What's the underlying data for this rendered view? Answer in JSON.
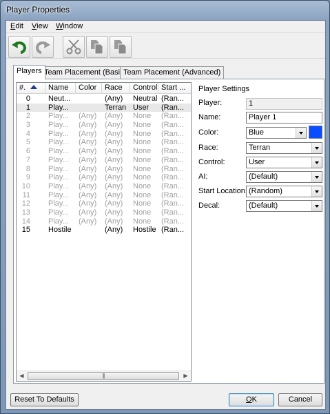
{
  "window": {
    "title": "Player Properties"
  },
  "menu": [
    {
      "key": "E",
      "rest": "dit"
    },
    {
      "key": "V",
      "rest": "iew"
    },
    {
      "key": "W",
      "rest": "indow"
    }
  ],
  "toolbar": {
    "buttons": [
      "undo-icon",
      "redo-icon",
      "cut-icon",
      "copy-icon",
      "paste-icon"
    ]
  },
  "tabs": [
    "Players",
    "Team Placement (Basic)",
    "Team Placement (Advanced)"
  ],
  "table": {
    "columns": [
      "#.",
      "Name",
      "Color",
      "Race",
      "Control",
      "Start ..."
    ],
    "rows": [
      [
        "0",
        "Neut...",
        "",
        "(Any)",
        "Neutral",
        "(Ran..."
      ],
      [
        "1",
        "Play...",
        "",
        "Terran",
        "User",
        "(Ran..."
      ],
      [
        "2",
        "Play...",
        "(Any)",
        "(Any)",
        "None",
        "(Ran..."
      ],
      [
        "3",
        "Play...",
        "(Any)",
        "(Any)",
        "None",
        "(Ran..."
      ],
      [
        "4",
        "Play...",
        "(Any)",
        "(Any)",
        "None",
        "(Ran..."
      ],
      [
        "5",
        "Play...",
        "(Any)",
        "(Any)",
        "None",
        "(Ran..."
      ],
      [
        "6",
        "Play...",
        "(Any)",
        "(Any)",
        "None",
        "(Ran..."
      ],
      [
        "7",
        "Play...",
        "(Any)",
        "(Any)",
        "None",
        "(Ran..."
      ],
      [
        "8",
        "Play...",
        "(Any)",
        "(Any)",
        "None",
        "(Ran..."
      ],
      [
        "9",
        "Play...",
        "(Any)",
        "(Any)",
        "None",
        "(Ran..."
      ],
      [
        "10",
        "Play...",
        "(Any)",
        "(Any)",
        "None",
        "(Ran..."
      ],
      [
        "11",
        "Play...",
        "(Any)",
        "(Any)",
        "None",
        "(Ran..."
      ],
      [
        "12",
        "Play...",
        "(Any)",
        "(Any)",
        "None",
        "(Ran..."
      ],
      [
        "13",
        "Play...",
        "(Any)",
        "(Any)",
        "None",
        "(Ran..."
      ],
      [
        "14",
        "Play...",
        "(Any)",
        "(Any)",
        "None",
        "(Ran..."
      ],
      [
        "15",
        "Hostile",
        "",
        "(Any)",
        "Hostile",
        "(Ran..."
      ]
    ],
    "disabled_rows": [
      2,
      3,
      4,
      5,
      6,
      7,
      8,
      9,
      10,
      11,
      12,
      13,
      14
    ],
    "selected_row": 1
  },
  "settings": {
    "title": "Player Settings",
    "player_label": "Player:",
    "player_value": "1",
    "name_label": "Name:",
    "name_value": "Player 1",
    "color_label": "Color:",
    "color_value": "Blue",
    "color_swatch": "#0a4cff",
    "race_label": "Race:",
    "race_value": "Terran",
    "control_label": "Control:",
    "control_value": "User",
    "ai_label": "AI:",
    "ai_value": "(Default)",
    "start_label": "Start Location:",
    "start_value": "(Random)",
    "decal_label": "Decal:",
    "decal_value": "(Default)"
  },
  "buttons": {
    "reset": "Reset To Defaults",
    "ok_key": "O",
    "ok_rest": "K",
    "cancel": "Cancel"
  }
}
